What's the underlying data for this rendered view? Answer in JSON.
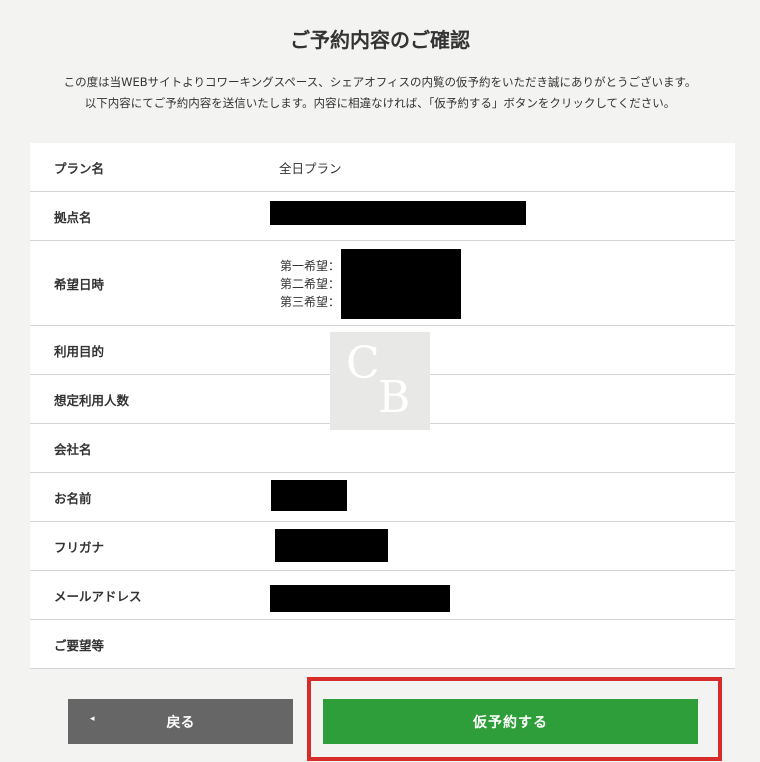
{
  "page": {
    "title": "ご予約内容のご確認",
    "intro_line1": "この度は当WEBサイトよりコワーキングスペース、シェアオフィスの内覧の仮予約をいただき誠にありがとうございます。",
    "intro_line2": "以下内容にてご予約内容を送信いたします。内容に相違なければ、「仮予約する」ボタンをクリックしてください。"
  },
  "form": {
    "rows": [
      {
        "label": "プラン名",
        "value": "全日プラン"
      },
      {
        "label": "拠点名",
        "value": ""
      },
      {
        "label": "希望日時",
        "value": ""
      },
      {
        "label": "利用目的",
        "value": ""
      },
      {
        "label": "想定利用人数",
        "value": ""
      },
      {
        "label": "会社名",
        "value": ""
      },
      {
        "label": "お名前",
        "value": ""
      },
      {
        "label": "フリガナ",
        "value": ""
      },
      {
        "label": "メールアドレス",
        "value": ""
      },
      {
        "label": "ご要望等",
        "value": ""
      }
    ],
    "hope": {
      "first": "第一希望：",
      "second": "第二希望：",
      "third": "第三希望："
    }
  },
  "watermark": {
    "letter1": "C",
    "letter2": "B"
  },
  "buttons": {
    "back_icon": "◂",
    "back_label": "戻る",
    "submit_label": "仮予約する"
  },
  "colors": {
    "background": "#f3f3f1",
    "submit": "#2e9e3a",
    "back": "#666666",
    "highlight": "#d62c2c"
  }
}
